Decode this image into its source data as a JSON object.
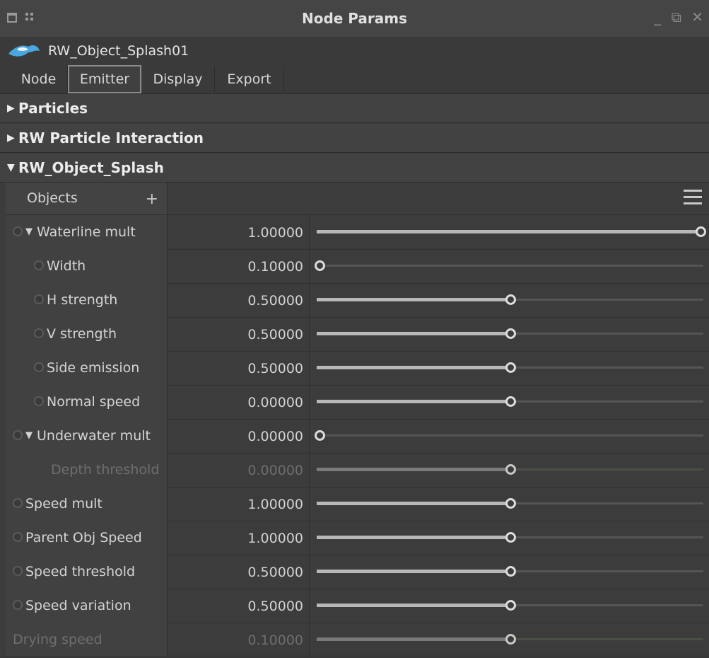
{
  "window": {
    "title": "Node Params",
    "controls": "_ ⧉ ✕"
  },
  "node": {
    "name": "RW_Object_Splash01"
  },
  "tabs": [
    {
      "label": "Node",
      "active": false
    },
    {
      "label": "Emitter",
      "active": true
    },
    {
      "label": "Display",
      "active": false
    },
    {
      "label": "Export",
      "active": false
    }
  ],
  "sections": [
    {
      "label": "Particles",
      "expanded": false
    },
    {
      "label": "RW Particle Interaction",
      "expanded": false
    },
    {
      "label": "RW_Object_Splash",
      "expanded": true
    }
  ],
  "objects": {
    "label": "Objects",
    "add": "+"
  },
  "params": [
    {
      "label": "Waterline mult",
      "value": "1.00000",
      "fraction": 1.0,
      "indent": 0,
      "caret": true,
      "radio": true,
      "disabled": false
    },
    {
      "label": "Width",
      "value": "0.10000",
      "fraction": 0.0,
      "indent": 1,
      "caret": false,
      "radio": true,
      "disabled": false
    },
    {
      "label": "H strength",
      "value": "0.50000",
      "fraction": 0.5,
      "indent": 1,
      "caret": false,
      "radio": true,
      "disabled": false
    },
    {
      "label": "V strength",
      "value": "0.50000",
      "fraction": 0.5,
      "indent": 1,
      "caret": false,
      "radio": true,
      "disabled": false
    },
    {
      "label": "Side emission",
      "value": "0.50000",
      "fraction": 0.5,
      "indent": 1,
      "caret": false,
      "radio": true,
      "disabled": false
    },
    {
      "label": "Normal speed",
      "value": "0.00000",
      "fraction": 0.5,
      "indent": 1,
      "caret": false,
      "radio": true,
      "disabled": false
    },
    {
      "label": "Underwater mult",
      "value": "0.00000",
      "fraction": 0.0,
      "indent": 0,
      "caret": true,
      "radio": true,
      "disabled": false
    },
    {
      "label": "Depth threshold",
      "value": "0.00000",
      "fraction": 0.5,
      "indent": 2,
      "caret": false,
      "radio": false,
      "disabled": true
    },
    {
      "label": "Speed mult",
      "value": "1.00000",
      "fraction": 0.5,
      "indent": 0,
      "caret": false,
      "radio": true,
      "disabled": false
    },
    {
      "label": "Parent Obj Speed",
      "value": "1.00000",
      "fraction": 0.5,
      "indent": 0,
      "caret": false,
      "radio": true,
      "disabled": false
    },
    {
      "label": "Speed threshold",
      "value": "0.50000",
      "fraction": 0.5,
      "indent": 0,
      "caret": false,
      "radio": true,
      "disabled": false
    },
    {
      "label": "Speed variation",
      "value": "0.50000",
      "fraction": 0.5,
      "indent": 0,
      "caret": false,
      "radio": true,
      "disabled": false
    },
    {
      "label": "Drying speed",
      "value": "0.10000",
      "fraction": 0.5,
      "indent": 0,
      "caret": false,
      "radio": false,
      "disabled": true
    }
  ]
}
